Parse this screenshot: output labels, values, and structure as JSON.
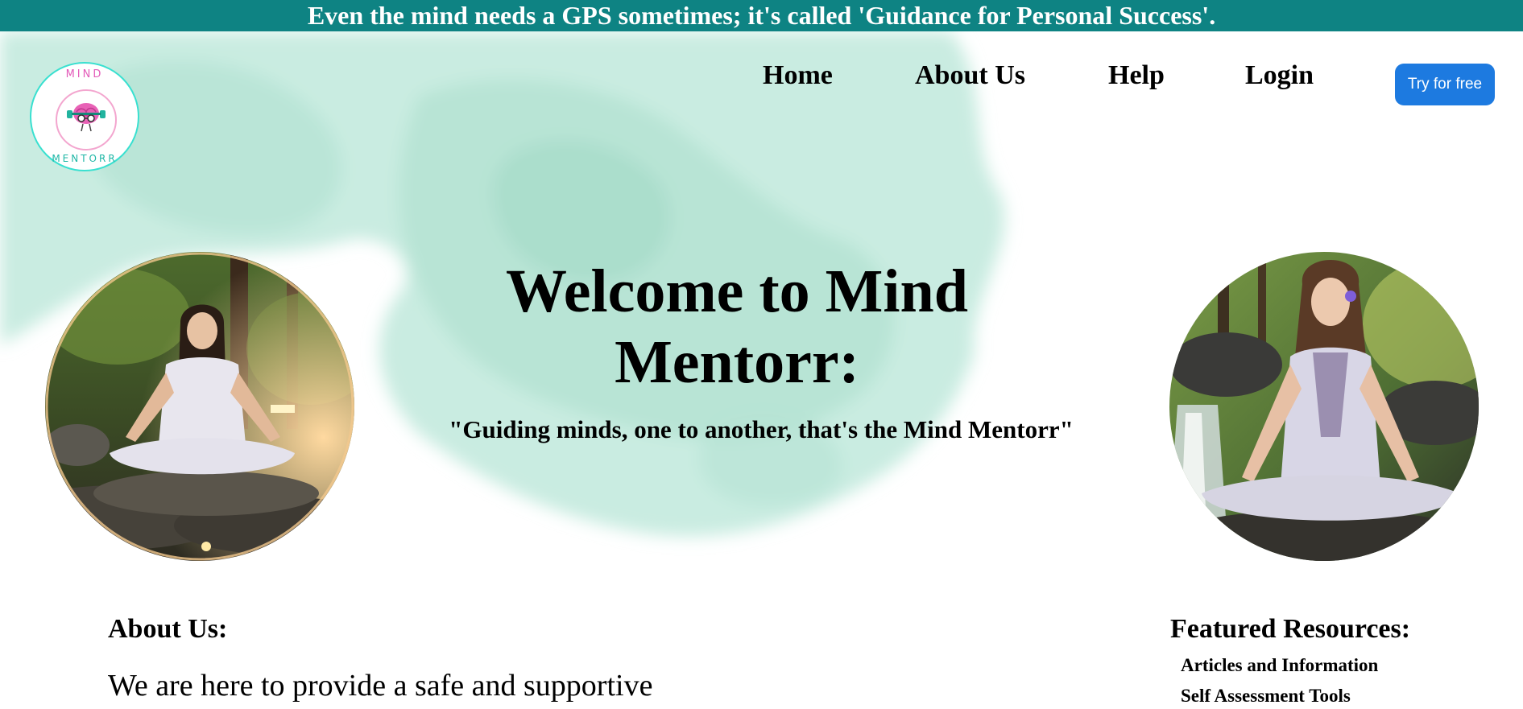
{
  "banner": {
    "text": "Even the mind needs a GPS sometimes; it's called 'Guidance for Personal Success'."
  },
  "logo": {
    "top_text": "MIND",
    "bottom_text": "MENTORR",
    "icon": "brain-with-dumbbells-icon"
  },
  "nav": {
    "items": [
      {
        "label": "Home"
      },
      {
        "label": "About Us"
      },
      {
        "label": "Help"
      },
      {
        "label": "Login"
      }
    ],
    "cta_label": "Try for free"
  },
  "hero": {
    "title": "Welcome to Mind Mentorr:",
    "tagline": "\"Guiding minds, one to another, that's the Mind Mentorr\""
  },
  "images": {
    "left": "meditating-woman-forest-photo",
    "right": "meditating-woman-stream-photo"
  },
  "about": {
    "heading": "About Us:",
    "text": "We are here to provide a safe and supportive"
  },
  "featured": {
    "heading": "Featured Resources:",
    "items": [
      {
        "label": "Articles and Information"
      },
      {
        "label": "Self Assessment Tools"
      }
    ]
  },
  "colors": {
    "banner": "#0e8383",
    "button": "#1d7ae0",
    "wash": "#bfe8da"
  }
}
